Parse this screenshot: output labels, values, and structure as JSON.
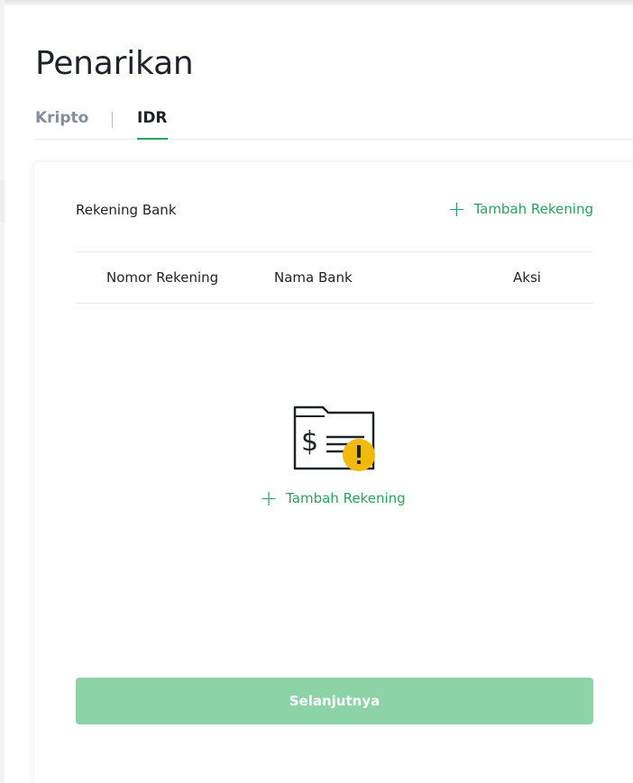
{
  "page": {
    "title": "Penarikan"
  },
  "tabs": [
    {
      "label": "Kripto",
      "active": false
    },
    {
      "label": "IDR",
      "active": true
    }
  ],
  "bank_section": {
    "label": "Rekening Bank",
    "add_label": "Tambah Rekening"
  },
  "table": {
    "columns": [
      "Nomor Rekening",
      "Nama Bank",
      "Aksi"
    ],
    "rows": []
  },
  "empty_state": {
    "icon": "folder-dollar-warning-icon",
    "add_label": "Tambah Rekening"
  },
  "actions": {
    "next_label": "Selanjutnya"
  },
  "colors": {
    "accent": "#28a35d",
    "button_disabled": "#8dd3a8",
    "warning": "#f0b90b",
    "text_primary": "#1e2329",
    "text_muted": "#848e9c"
  }
}
